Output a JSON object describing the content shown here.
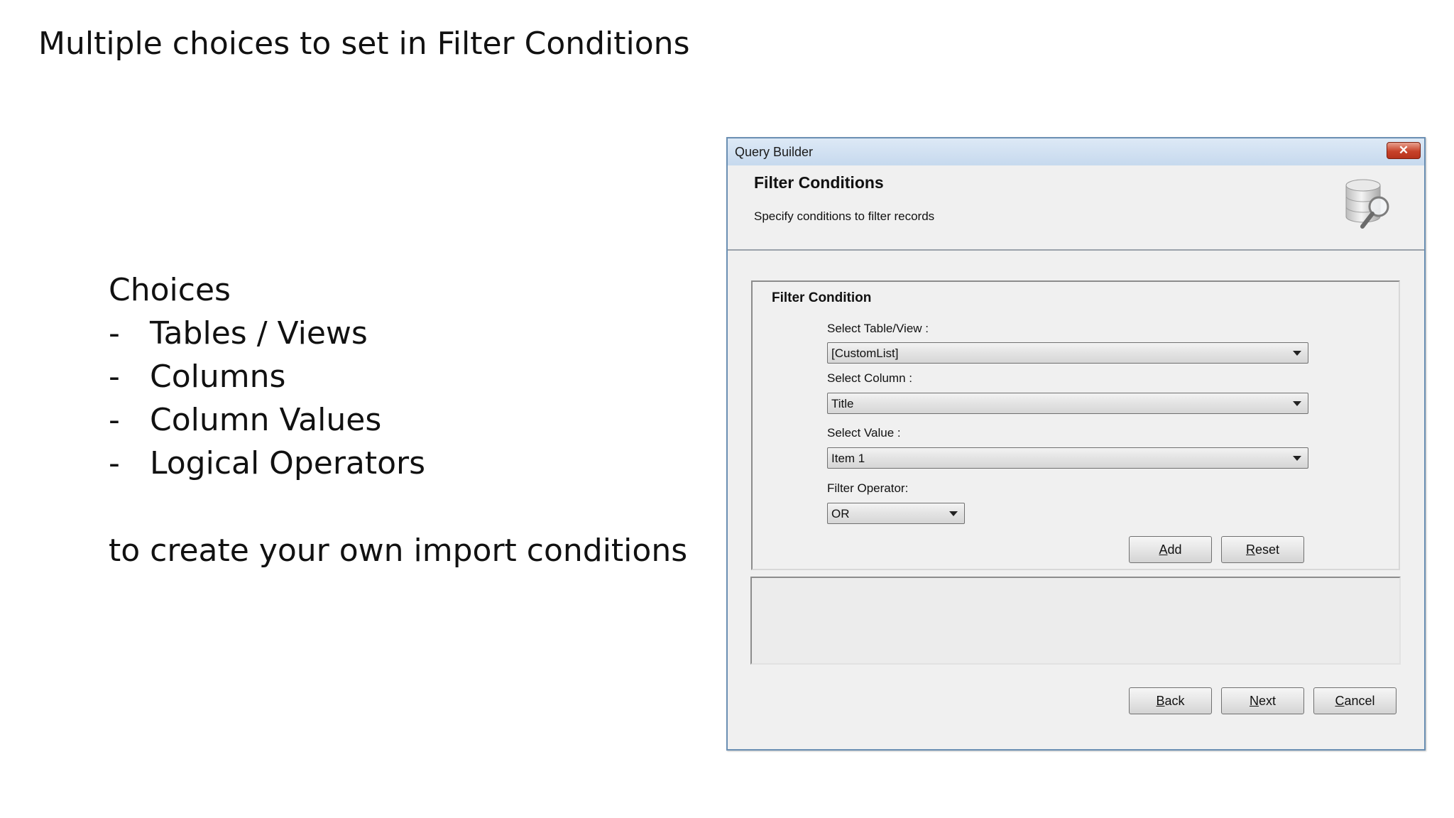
{
  "slide": {
    "title": "Multiple choices to set in Filter Conditions",
    "choices_heading": "Choices",
    "choices": [
      {
        "dash": "-",
        "label": "Tables / Views"
      },
      {
        "dash": "-",
        "label": "Columns"
      },
      {
        "dash": "-",
        "label": "Column Values"
      },
      {
        "dash": "-",
        "label": "Logical Operators"
      }
    ],
    "tail": "to create your own import conditions"
  },
  "dialog": {
    "window_title": "Query Builder",
    "close_glyph": "✕",
    "header_title": "Filter Conditions",
    "header_subtitle": "Specify conditions to filter records",
    "header_icon": "database-search-icon",
    "group_title": "Filter Condition",
    "table_label": "Select Table/View :",
    "table_value": "[CustomList]",
    "column_label": "Select Column :",
    "column_value": "Title",
    "value_label": "Select Value :",
    "value_value": "Item 1",
    "operator_label": "Filter Operator:",
    "operator_value": "OR",
    "buttons": {
      "add": {
        "first": "A",
        "rest": "dd"
      },
      "reset": {
        "first": "R",
        "rest": "eset"
      },
      "back": {
        "first": "B",
        "rest": "ack"
      },
      "next": {
        "first": "N",
        "rest": "ext"
      },
      "cancel": {
        "first": "C",
        "rest": "ancel"
      }
    }
  }
}
